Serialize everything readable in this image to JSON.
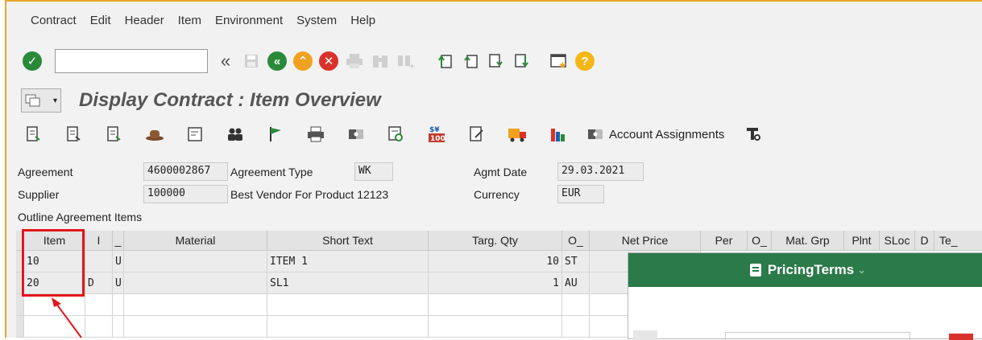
{
  "menu": [
    "Contract",
    "Edit",
    "Header",
    "Item",
    "Environment",
    "System",
    "Help"
  ],
  "command_field": {
    "value": ""
  },
  "toolbar": {
    "back_double": "«",
    "help_icon": "?"
  },
  "title": "Display Contract : Item Overview",
  "app_toolbar": {
    "account_assignments_label": "Account Assignments"
  },
  "header": {
    "agreement_label": "Agreement",
    "agreement_value": "4600002867",
    "agreement_type_label": "Agreement Type",
    "agreement_type_value": "WK",
    "agmt_date_label": "Agmt Date",
    "agmt_date_value": "29.03.2021",
    "supplier_label": "Supplier",
    "supplier_value": "100000",
    "supplier_name": "Best Vendor For Product 12123",
    "currency_label": "Currency",
    "currency_value": "EUR"
  },
  "section_title": "Outline Agreement Items",
  "table": {
    "columns": [
      "Item",
      "I",
      "_",
      "Material",
      "Short Text",
      "Targ. Qty",
      "O_",
      "Net Price",
      "Per",
      "O_",
      "Mat. Grp",
      "Plnt",
      "SLoc",
      "D",
      "Te_"
    ],
    "rows": [
      {
        "item": "10",
        "i": "",
        "a": "U",
        "material": "",
        "short_text": "ITEM 1",
        "targ_qty": "10",
        "o": "ST"
      },
      {
        "item": "20",
        "i": "D",
        "a": "U",
        "material": "",
        "short_text": "SL1",
        "targ_qty": "1",
        "o": "AU"
      }
    ]
  },
  "pricing_terms": {
    "title": "PricingTerms",
    "chevron": "⌄"
  },
  "colors": {
    "accent_border": "#e9a52d",
    "highlight": "#e3161b",
    "pricing_header": "#2b7a49"
  }
}
